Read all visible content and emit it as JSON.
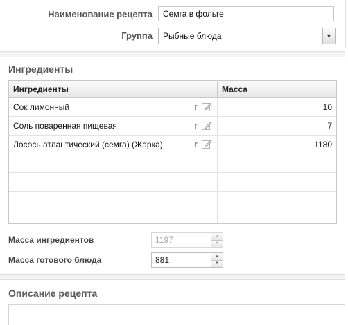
{
  "recipe_form": {
    "name_label": "Наименование рецепта",
    "name_value": "Семга в фольге",
    "group_label": "Группа",
    "group_value": "Рыбные блюда"
  },
  "ingredients_section": {
    "title": "Ингредиенты",
    "columns": [
      "Ингредиенты",
      "Масса"
    ],
    "rows": [
      {
        "name": "Сок лимонный",
        "unit": "г",
        "mass": "10"
      },
      {
        "name": "Соль поваренная пищевая",
        "unit": "г",
        "mass": "7"
      },
      {
        "name": "Лосось атлантический (семга) (Жарка)",
        "unit": "г",
        "mass": "1180"
      }
    ]
  },
  "totals": {
    "ingredients_mass_label": "Масса  ингредиентов",
    "ingredients_mass_value": "1197",
    "dish_mass_label": "Масса готового блюда",
    "dish_mass_value": "881"
  },
  "description_section": {
    "title": "Описание рецепта"
  },
  "icons": {
    "edit": "edit-pencil-icon",
    "dropdown": "chevron-down-icon",
    "spin_up": "arrow-up-icon",
    "spin_down": "arrow-down-icon"
  }
}
